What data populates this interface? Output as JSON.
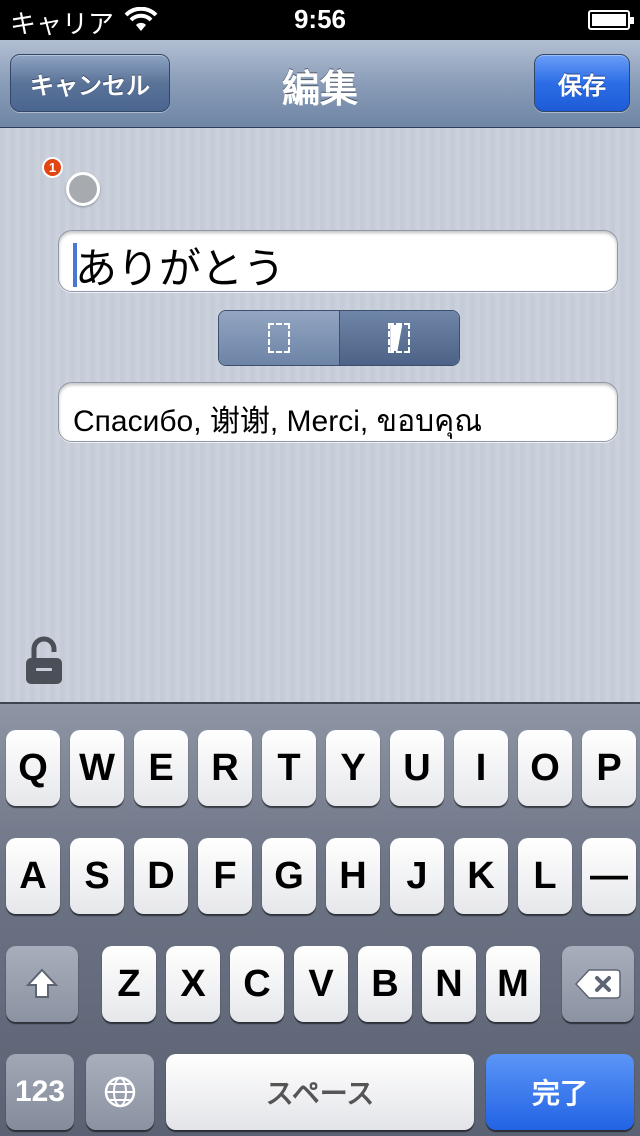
{
  "status_bar": {
    "carrier": "キャリア",
    "time": "9:56"
  },
  "navbar": {
    "cancel_label": "キャンセル",
    "title": "編集",
    "save_label": "保存"
  },
  "content": {
    "badge_count": "1",
    "main_field_value": "ありがとう",
    "sub_field_value": "Спасибо, 谢谢, Merci, ขอบคุณ"
  },
  "keyboard": {
    "row1": [
      "Q",
      "W",
      "E",
      "R",
      "T",
      "Y",
      "U",
      "I",
      "O",
      "P"
    ],
    "row2": [
      "A",
      "S",
      "D",
      "F",
      "G",
      "H",
      "J",
      "K",
      "L",
      "—"
    ],
    "row3": [
      "Z",
      "X",
      "C",
      "V",
      "B",
      "N",
      "M"
    ],
    "numbers_label": "123",
    "space_label": "スペース",
    "done_label": "完了"
  },
  "icons": {
    "wifi": "wifi-icon",
    "battery": "battery-icon",
    "lock": "lock-icon",
    "shift": "shift-icon",
    "delete": "delete-icon",
    "globe": "globe-icon"
  },
  "colors": {
    "accent_blue": "#2c6de6",
    "badge_red": "#e04512"
  }
}
